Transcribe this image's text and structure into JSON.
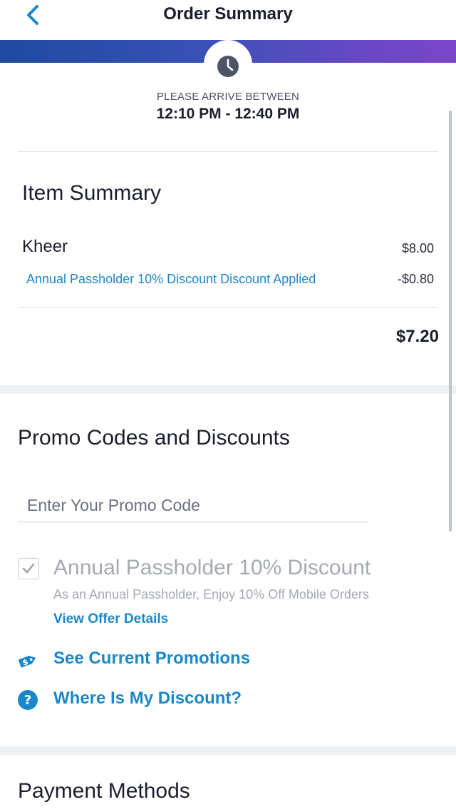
{
  "header": {
    "title": "Order Summary"
  },
  "arrival": {
    "label": "PLEASE ARRIVE BETWEEN",
    "window": "12:10 PM - 12:40 PM"
  },
  "item_summary": {
    "heading": "Item Summary",
    "items": [
      {
        "name": "Kheer",
        "price": "$8.00"
      }
    ],
    "discount": {
      "label": "Annual Passholder 10% Discount Discount Applied",
      "value": "-$0.80"
    },
    "total": "$7.20"
  },
  "promo": {
    "heading": "Promo Codes and Discounts",
    "input_placeholder": "Enter Your Promo Code",
    "input_value": "",
    "passholder": {
      "title": "Annual Passholder 10% Discount",
      "description": "As an Annual Passholder, Enjoy 10% Off Mobile Orders",
      "checked": true,
      "view_offer_label": "View Offer Details"
    },
    "see_promotions_label": "See Current Promotions",
    "where_discount_label": "Where Is My Discount?"
  },
  "payment": {
    "heading": "Payment Methods"
  },
  "colors": {
    "accent": "#1a87c9",
    "text_dark": "#1b1f2d",
    "muted": "#a4a9b3",
    "gradient_start": "#1f4aa0",
    "gradient_end": "#7a45c8",
    "band_gray": "#eef2f4"
  },
  "icons": {
    "back": "chevron-left-icon",
    "clock": "clock-icon",
    "check": "checkmark-icon",
    "tag": "price-tag-icon",
    "help": "question-circle-icon"
  }
}
